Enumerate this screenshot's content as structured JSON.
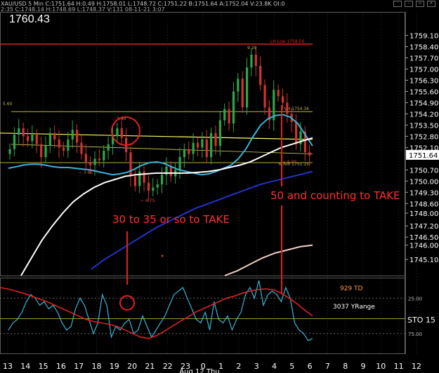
{
  "header": {
    "title": "XAU/USD 5 Min C:1751.64 H:0.49 H:1758.01 L:1748.72 C:1751.22 B:1751.64 A:1752.04 V:23.8K OI:0",
    "ohlc_line": "2:35 C:1748.14 H:1748.69 L:1748.37 V:131 08-11-21 3:07",
    "icons": [
      "pin-icon",
      "minimize-icon",
      "restore-icon",
      "close-icon"
    ]
  },
  "current_price_display": "1760.43",
  "chart_data": [
    {
      "type": "line",
      "panel": "price",
      "title": "XAU/USD 5 Min",
      "ylim": [
        1744.1,
        1760.0
      ],
      "y_ticks": [
        1745.1,
        1746.0,
        1746.5,
        1747.2,
        1748.0,
        1748.6,
        1749.3,
        1750.0,
        1750.7,
        1751.64,
        1752.1,
        1752.8,
        1753.5,
        1754.2,
        1754.9,
        1755.6,
        1756.3,
        1757.0,
        1757.7,
        1758.4,
        1759.1
      ],
      "y_tick_labels": [
        "1745.10",
        "1746.00",
        "1746.50",
        "1747.20",
        "1748.00",
        "1748.60",
        "1749.30",
        "1750.00",
        "1750.70",
        "1751.64",
        "1752.10",
        "1752.80",
        "1753.50",
        "1754.20",
        "1754.90",
        "1755.60",
        "1756.30",
        "1757.00",
        "1757.70",
        "1758.40",
        "1759.10"
      ],
      "current_price_label": "1751.64",
      "x_labels": [
        "13",
        "14",
        "15",
        "16",
        "17",
        "18",
        "19",
        "20",
        "21",
        "22",
        "23",
        "0",
        "1",
        "2",
        "3",
        "4",
        "5",
        "6",
        "7",
        "8",
        "9",
        "10",
        "11",
        "12"
      ],
      "x_center_label": "Aug 12 Thu",
      "close": [
        1752.0,
        1752.9,
        1753.3,
        1752.8,
        1752.5,
        1752.9,
        1752.3,
        1751.5,
        1752.2,
        1753.0,
        1752.6,
        1752.1,
        1751.9,
        1752.6,
        1753.2,
        1752.4,
        1751.7,
        1751.2,
        1751.0,
        1751.4,
        1751.3,
        1751.9,
        1752.3,
        1752.8,
        1753.3,
        1752.7,
        1751.8,
        1750.3,
        1749.7,
        1750.6,
        1749.9,
        1749.4,
        1749.6,
        1749.8,
        1750.4,
        1750.9,
        1750.3,
        1750.7,
        1751.5,
        1752.0,
        1751.7,
        1752.4,
        1752.1,
        1752.6,
        1751.5,
        1753.0,
        1752.2,
        1753.8,
        1754.5,
        1753.6,
        1755.6,
        1756.4,
        1754.6,
        1757.1,
        1757.9,
        1757.2,
        1756.0,
        1754.6,
        1753.8,
        1755.7,
        1755.3,
        1754.9,
        1754.2,
        1753.7,
        1752.3,
        1753.1,
        1751.8,
        1751.6
      ],
      "series": [
        {
          "name": "",
          "color": "#3ab5d6",
          "values": [
            1750.8,
            1750.9,
            1751.0,
            1751.05,
            1751.05,
            1751.0,
            1750.9,
            1750.85,
            1750.85,
            1750.8,
            1750.75,
            1750.7,
            1750.6,
            1750.5,
            1750.4,
            1750.45,
            1750.55,
            1750.75,
            1751.0,
            1751.15,
            1751.2,
            1751.1,
            1750.9,
            1750.7,
            1750.6,
            1750.5,
            1750.4,
            1750.45,
            1750.6,
            1750.8,
            1751.0,
            1751.4,
            1752.0,
            1752.8,
            1753.5,
            1753.9,
            1754.1,
            1754.15,
            1754.0,
            1753.6,
            1752.9,
            1752.2
          ]
        },
        {
          "name": "",
          "color": "#ffffff",
          "values": [
            1744.1,
            1745.2,
            1746.3,
            1747.2,
            1748.0,
            1748.7,
            1749.2,
            1749.6,
            1749.9,
            1750.1,
            1750.3,
            1750.4,
            1750.45,
            1750.5,
            1750.5,
            1750.5,
            1750.5,
            1750.55,
            1750.6,
            1750.7,
            1750.85,
            1751.0,
            1751.2,
            1751.5,
            1751.8,
            1752.1,
            1752.3,
            1752.5,
            1752.7
          ]
        },
        {
          "name": "",
          "color": "#2233cc",
          "values": [
            1744.5,
            1745.1,
            1745.6,
            1746.1,
            1746.6,
            1747.1,
            1747.5,
            1747.9,
            1748.3,
            1748.6,
            1748.9,
            1749.2,
            1749.5,
            1749.8,
            1750.0,
            1750.2,
            1750.4,
            1750.6
          ]
        },
        {
          "name": "",
          "color": "#f0d0c8",
          "values": [
            1744.1,
            1744.4,
            1744.8,
            1745.2,
            1745.5,
            1745.7,
            1745.9,
            1746.0
          ]
        }
      ],
      "horizontal_lines": [
        {
          "label": "LH Low 1758.56",
          "value": 1758.56,
          "color": "#e02020"
        },
        {
          "label": "VH 1754.34",
          "value": 1754.34,
          "color": "#b8b83a"
        },
        {
          "label": "ROVR 1751.15",
          "value": 1751.15,
          "color": "#b8b83a"
        }
      ],
      "annotations": [
        {
          "text": "5.60",
          "color": "#b8b83a"
        },
        {
          "text": "2.90",
          "color": "#b8b83a"
        },
        {
          "text": "9.29",
          "color": "#b8b83a"
        },
        {
          "text": "~ 3.85",
          "color": "#e05040"
        },
        {
          "text": "~ 4.75",
          "color": "#e05040"
        },
        {
          "text": "~ 6.00",
          "color": "#e05040"
        },
        {
          "text": "30 to 35 or so to TAKE",
          "color": "#ff3030"
        },
        {
          "text": "50 and counting to TAKE",
          "color": "#ff3030"
        }
      ]
    },
    {
      "type": "line",
      "panel": "oscillator",
      "title": "STO 15",
      "ylim": [
        0,
        100
      ],
      "y_ticks": [
        25,
        75
      ],
      "y_tick_labels": [
        "25.00",
        "75.00"
      ],
      "series": [
        {
          "name": "",
          "color": "#3ab5d6",
          "values": [
            70,
            60,
            55,
            45,
            30,
            20,
            25,
            35,
            30,
            40,
            35,
            45,
            60,
            70,
            65,
            40,
            25,
            35,
            55,
            75,
            60,
            20,
            35,
            80,
            65,
            70,
            60,
            55,
            75,
            70,
            50,
            65,
            80,
            70,
            60,
            50,
            35,
            20,
            15,
            10,
            25,
            40,
            55,
            60,
            45,
            70,
            30,
            55,
            60,
            50,
            70,
            55,
            45,
            20,
            10,
            25,
            0,
            35,
            20,
            15,
            20,
            30,
            10,
            25,
            60,
            70,
            75,
            85,
            82
          ]
        },
        {
          "name": "",
          "color": "#dd2222",
          "values": [
            10,
            12,
            15,
            18,
            22,
            26,
            30,
            35,
            40,
            45,
            50,
            55,
            58,
            60,
            62,
            65,
            70,
            75,
            80,
            82,
            78,
            72,
            65,
            58,
            52,
            45,
            40,
            35,
            30,
            25,
            22,
            18,
            15,
            13,
            12,
            13,
            18,
            25,
            33,
            42,
            50
          ]
        }
      ],
      "labels": [
        {
          "text": "929 TD",
          "color": "#ff9a40"
        },
        {
          "text": "3037 YRange",
          "color": "#ffffff"
        },
        {
          "text": "STO 15",
          "color": "#ffffff"
        }
      ]
    }
  ]
}
